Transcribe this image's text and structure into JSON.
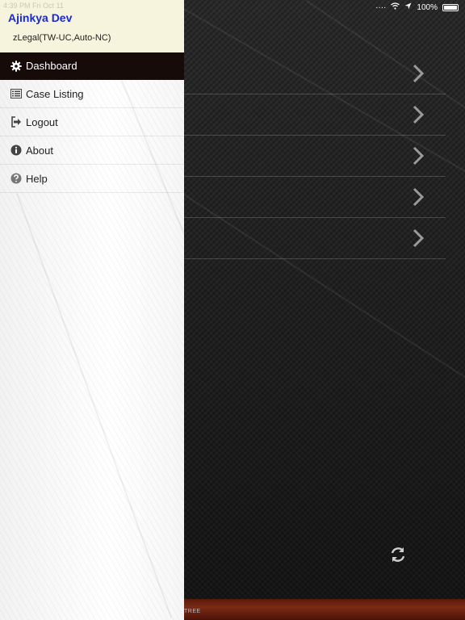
{
  "status": {
    "left_text": "4:39 PM  Fri Oct 11",
    "battery": "100%"
  },
  "drawer": {
    "user_name": "Ajinkya Dev",
    "org": "zLegal(TW-UC,Auto-NC)",
    "items": [
      {
        "label": "Dashboard",
        "icon": "gear-icon",
        "active": true
      },
      {
        "label": "Case Listing",
        "icon": "list-icon",
        "active": false
      },
      {
        "label": "Logout",
        "icon": "logout-icon",
        "active": false
      },
      {
        "label": "About",
        "icon": "info-icon",
        "active": false
      },
      {
        "label": "Help",
        "icon": "help-icon",
        "active": false
      }
    ]
  },
  "footer": {
    "logo_text": "TREE"
  },
  "colors": {
    "accent_name": "#1a2ad0",
    "active_bg": "#160b08",
    "profile_bg": "#f6f4dc"
  }
}
